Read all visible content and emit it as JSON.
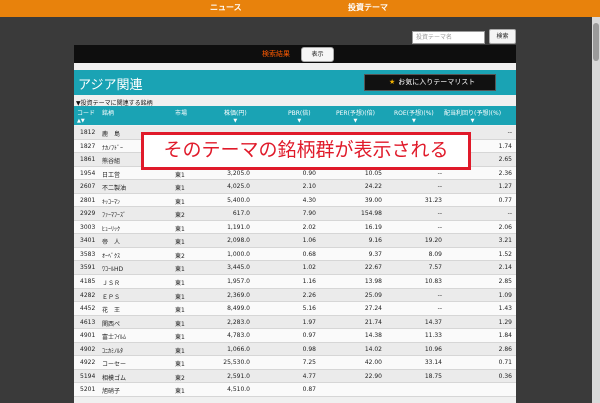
{
  "nav": {
    "news": "ニュース",
    "theme": "投資テーマ"
  },
  "search": {
    "placeholder": "投資テーマ名",
    "button": "検索"
  },
  "result": {
    "label": "検索結果",
    "display_button": "表示"
  },
  "theme": {
    "title": "アジア関連",
    "fav_button": "お気に入りテーマリスト"
  },
  "section_label": "▼投資テーマに関連する銘柄",
  "columns": {
    "code": "コード",
    "name": "銘柄",
    "market": "市場",
    "price": "株価(円)",
    "pbr": "PBR(倍)",
    "per": "PER(予想)(倍)",
    "roe": "ROE(予想)(%)",
    "yield": "配当利回り(予想)(%)",
    "arrow": "▼",
    "arrow_code": "▲▼"
  },
  "callout": "そのテーマの銘柄群が表示される",
  "rows": [
    {
      "code": "1812",
      "name": "鹿　島",
      "market": "",
      "price": "",
      "pbr": "",
      "per": "",
      "roe": "",
      "yield": "--"
    },
    {
      "code": "1827",
      "name": "ﾅｶﾉﾌﾄﾞｰ",
      "market": "",
      "price": "",
      "pbr": "",
      "per": "",
      "roe": "",
      "yield": "1.74"
    },
    {
      "code": "1861",
      "name": "熊谷組",
      "market": "",
      "price": "",
      "pbr": "",
      "per": "",
      "roe": "",
      "yield": "2.65"
    },
    {
      "code": "1954",
      "name": "日工営",
      "market": "東1",
      "price": "3,205.0",
      "pbr": "0.90",
      "per": "10.05",
      "roe": "--",
      "yield": "2.36"
    },
    {
      "code": "2607",
      "name": "不二製油",
      "market": "東1",
      "price": "4,025.0",
      "pbr": "2.10",
      "per": "24.22",
      "roe": "--",
      "yield": "1.27"
    },
    {
      "code": "2801",
      "name": "ｷｯｺｰﾏﾝ",
      "market": "東1",
      "price": "5,400.0",
      "pbr": "4.30",
      "per": "39.00",
      "roe": "31.23",
      "yield": "0.77"
    },
    {
      "code": "2929",
      "name": "ﾌｧｰﾏﾌｰｽﾞ",
      "market": "東2",
      "price": "617.0",
      "pbr": "7.90",
      "per": "154.98",
      "roe": "--",
      "yield": "--"
    },
    {
      "code": "3003",
      "name": "ﾋｭｰﾘｯｸ",
      "market": "東1",
      "price": "1,191.0",
      "pbr": "2.02",
      "per": "16.19",
      "roe": "--",
      "yield": "2.06"
    },
    {
      "code": "3401",
      "name": "帝　人",
      "market": "東1",
      "price": "2,098.0",
      "pbr": "1.06",
      "per": "9.16",
      "roe": "19.20",
      "yield": "3.21"
    },
    {
      "code": "3583",
      "name": "ｵｰﾍﾞｸｽ",
      "market": "東2",
      "price": "1,000.0",
      "pbr": "0.68",
      "per": "9.37",
      "roe": "8.09",
      "yield": "1.52"
    },
    {
      "code": "3591",
      "name": "ﾜｺｰﾙHD",
      "market": "東1",
      "price": "3,445.0",
      "pbr": "1.02",
      "per": "22.67",
      "roe": "7.57",
      "yield": "2.14"
    },
    {
      "code": "4185",
      "name": "ＪＳＲ",
      "market": "東1",
      "price": "1,957.0",
      "pbr": "1.16",
      "per": "13.98",
      "roe": "10.83",
      "yield": "2.85"
    },
    {
      "code": "4282",
      "name": "ＥＰＳ",
      "market": "東1",
      "price": "2,369.0",
      "pbr": "2.26",
      "per": "25.09",
      "roe": "--",
      "yield": "1.09"
    },
    {
      "code": "4452",
      "name": "花　王",
      "market": "東1",
      "price": "8,499.0",
      "pbr": "5.16",
      "per": "27.24",
      "roe": "--",
      "yield": "1.43"
    },
    {
      "code": "4613",
      "name": "関西ペ",
      "market": "東1",
      "price": "2,283.0",
      "pbr": "1.97",
      "per": "21.74",
      "roe": "14.37",
      "yield": "1.29"
    },
    {
      "code": "4901",
      "name": "富士ﾌｲﾙﾑ",
      "market": "東1",
      "price": "4,783.0",
      "pbr": "0.97",
      "per": "14.38",
      "roe": "11.33",
      "yield": "1.84"
    },
    {
      "code": "4902",
      "name": "ｺﾆｶﾐﾉﾙﾀ",
      "market": "東1",
      "price": "1,066.0",
      "pbr": "0.98",
      "per": "14.02",
      "roe": "10.96",
      "yield": "2.86"
    },
    {
      "code": "4922",
      "name": "コーセー",
      "market": "東1",
      "price": "25,530.0",
      "pbr": "7.25",
      "per": "42.00",
      "roe": "33.14",
      "yield": "0.71"
    },
    {
      "code": "5194",
      "name": "相模ゴム",
      "market": "東2",
      "price": "2,591.0",
      "pbr": "4.77",
      "per": "22.90",
      "roe": "18.75",
      "yield": "0.36"
    },
    {
      "code": "5201",
      "name": "旭硝子",
      "market": "東1",
      "price": "4,510.0",
      "pbr": "0.87",
      "per": "",
      "roe": "",
      "yield": ""
    }
  ]
}
